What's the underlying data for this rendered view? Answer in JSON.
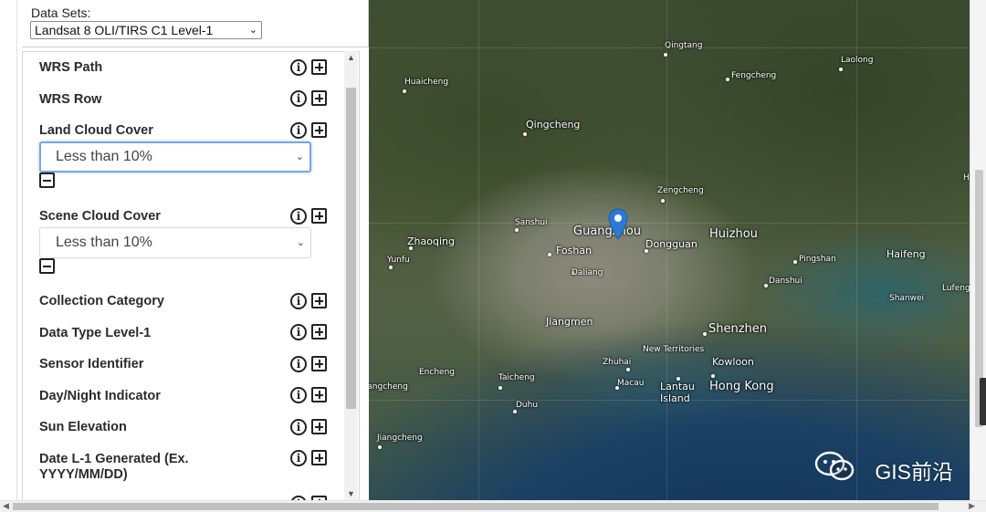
{
  "datasets": {
    "label": "Data Sets:",
    "selected": "Landsat 8 OLI/TIRS C1 Level-1"
  },
  "filters": [
    {
      "label": "WRS Path"
    },
    {
      "label": "WRS Row"
    },
    {
      "label": "Land Cloud Cover",
      "value": "Less than 10%"
    },
    {
      "label": "Scene Cloud Cover",
      "value": "Less than 10%"
    },
    {
      "label": "Collection Category"
    },
    {
      "label": "Data Type Level-1"
    },
    {
      "label": "Sensor Identifier"
    },
    {
      "label": "Day/Night Indicator"
    },
    {
      "label": "Sun Elevation"
    },
    {
      "label": "Date L-1 Generated (Ex. YYYY/MM/DD)"
    }
  ],
  "icons": {
    "info": "i",
    "chevron": "⌄",
    "up": "▲",
    "down": "▼",
    "left": "◀",
    "right": "▶"
  },
  "map": {
    "places": [
      "Qingtang",
      "Laolong",
      "Fengcheng",
      "Huaicheng",
      "Qingcheng",
      "Zengcheng",
      "Sanshui",
      "Guangzhou",
      "Huizhou",
      "Zhaoqing",
      "Foshan",
      "Dongguan",
      "Yunfu",
      "Pingshan",
      "Haifeng",
      "Daliang",
      "Danshui",
      "Shanwei",
      "Lufeng",
      "Jiangmen",
      "Shenzhen",
      "New Territories",
      "Zhuhai",
      "Kowloon",
      "Encheng",
      "Taicheng",
      "Macau",
      "Lantau Island",
      "Hong Kong",
      "Duhu",
      "Jiangcheng",
      "Yangcheng",
      "H"
    ],
    "marker_color": "#2b7bd6"
  },
  "watermark": "GIS前沿"
}
